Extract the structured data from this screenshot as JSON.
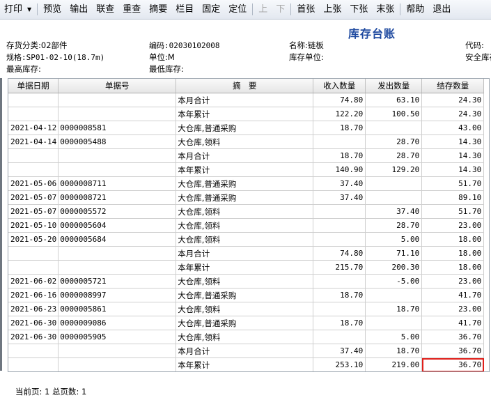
{
  "toolbar": {
    "items": [
      {
        "label": "打印",
        "enabled": true,
        "dropdown": true
      },
      {
        "label": "预览",
        "enabled": true
      },
      {
        "label": "输出",
        "enabled": true
      },
      {
        "label": "联查",
        "enabled": true
      },
      {
        "label": "重查",
        "enabled": true
      },
      {
        "label": "摘要",
        "enabled": true
      },
      {
        "label": "栏目",
        "enabled": true
      },
      {
        "label": "固定",
        "enabled": true
      },
      {
        "label": "定位",
        "enabled": true
      },
      {
        "label": "上",
        "enabled": false
      },
      {
        "label": "下",
        "enabled": false
      },
      {
        "label": "首张",
        "enabled": true
      },
      {
        "label": "上张",
        "enabled": true
      },
      {
        "label": "下张",
        "enabled": true
      },
      {
        "label": "末张",
        "enabled": true
      },
      {
        "label": "帮助",
        "enabled": true
      },
      {
        "label": "退出",
        "enabled": true
      }
    ]
  },
  "header": {
    "title": "库存台账",
    "category": "存货分类:02部件",
    "spec": "规格:SP01-02-10(18.7m)",
    "max_stock": "最高库存:",
    "code": "编码:02030102008",
    "unit": "单位:M",
    "min_stock": "最低库存:",
    "name": "名称:链板",
    "stock_unit": "库存单位:",
    "daima": "代码:",
    "safety": "安全库存"
  },
  "table": {
    "columns": [
      "单据日期",
      "单据号",
      "摘　要",
      "收入数量",
      "发出数量",
      "结存数量"
    ],
    "rows": [
      [
        "",
        "",
        "本月合计",
        "74.80",
        "63.10",
        "24.30"
      ],
      [
        "",
        "",
        "本年累计",
        "122.20",
        "100.50",
        "24.30"
      ],
      [
        "2021-04-12",
        "0000008581",
        "大仓库,普通采购",
        "18.70",
        "",
        "43.00"
      ],
      [
        "2021-04-14",
        "0000005488",
        "大仓库,领料",
        "",
        "28.70",
        "14.30"
      ],
      [
        "",
        "",
        "本月合计",
        "18.70",
        "28.70",
        "14.30"
      ],
      [
        "",
        "",
        "本年累计",
        "140.90",
        "129.20",
        "14.30"
      ],
      [
        "2021-05-06",
        "0000008711",
        "大仓库,普通采购",
        "37.40",
        "",
        "51.70"
      ],
      [
        "2021-05-07",
        "0000008721",
        "大仓库,普通采购",
        "37.40",
        "",
        "89.10"
      ],
      [
        "2021-05-07",
        "0000005572",
        "大仓库,领料",
        "",
        "37.40",
        "51.70"
      ],
      [
        "2021-05-10",
        "0000005604",
        "大仓库,领料",
        "",
        "28.70",
        "23.00"
      ],
      [
        "2021-05-20",
        "0000005684",
        "大仓库,领料",
        "",
        "5.00",
        "18.00"
      ],
      [
        "",
        "",
        "本月合计",
        "74.80",
        "71.10",
        "18.00"
      ],
      [
        "",
        "",
        "本年累计",
        "215.70",
        "200.30",
        "18.00"
      ],
      [
        "2021-06-02",
        "0000005721",
        "大仓库,领料",
        "",
        "-5.00",
        "23.00"
      ],
      [
        "2021-06-16",
        "0000008997",
        "大仓库,普通采购",
        "18.70",
        "",
        "41.70"
      ],
      [
        "2021-06-23",
        "0000005861",
        "大仓库,领料",
        "",
        "18.70",
        "23.00"
      ],
      [
        "2021-06-30",
        "0000009086",
        "大仓库,普通采购",
        "18.70",
        "",
        "41.70"
      ],
      [
        "2021-06-30",
        "0000005905",
        "大仓库,领料",
        "",
        "5.00",
        "36.70"
      ],
      [
        "",
        "",
        "本月合计",
        "37.40",
        "18.70",
        "36.70"
      ],
      [
        "",
        "",
        "本年累计",
        "253.10",
        "219.00",
        "36.70"
      ]
    ],
    "highlight": {
      "row": 19,
      "col": 5,
      "color": "#e0201b"
    }
  },
  "status": {
    "text": "当前页: 1 总页数: 1"
  }
}
